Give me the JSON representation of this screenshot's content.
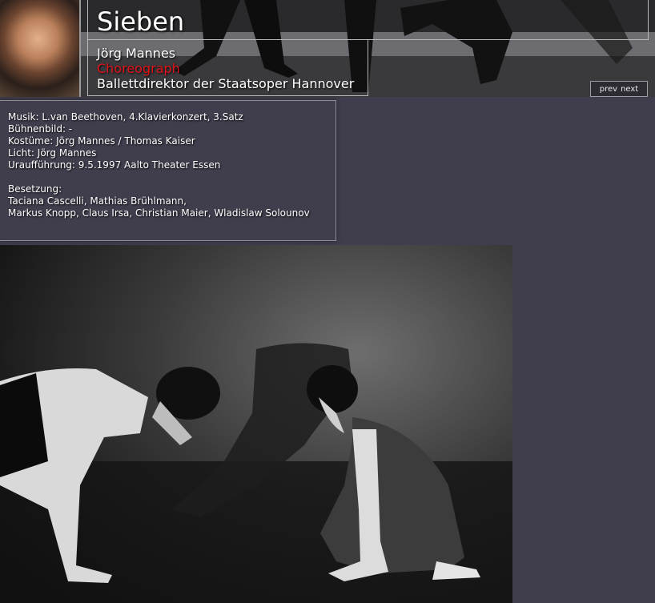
{
  "header": {
    "title": "Sieben",
    "person": {
      "name": "Jörg Mannes",
      "role": "Choreograph",
      "position": "Ballettdirektor der Staatsoper Hannover"
    },
    "pager": {
      "prev_label": "prev",
      "next_label": "next"
    }
  },
  "info": {
    "musik": "Musik: L.van Beethoven, 4.Klavierkonzert, 3.Satz",
    "buehnenbild": "Bühnenbild: -",
    "kostueme": "Kostüme: Jörg Mannes / Thomas Kaiser",
    "licht": "Licht: Jörg Mannes",
    "urauffuehrung": "Uraufführung: 9.5.1997 Aalto Theater Essen",
    "besetzung_label": "Besetzung:",
    "besetzung_line1": "Taciana Cascelli, Mathias Brühlmann,",
    "besetzung_line2": "Markus Knopp, Claus Irsa, Christian Maier, Wladislaw Solounov"
  },
  "colors": {
    "background": "#403e4d",
    "role_accent": "#e0151b",
    "border": "#b8b8bd"
  }
}
